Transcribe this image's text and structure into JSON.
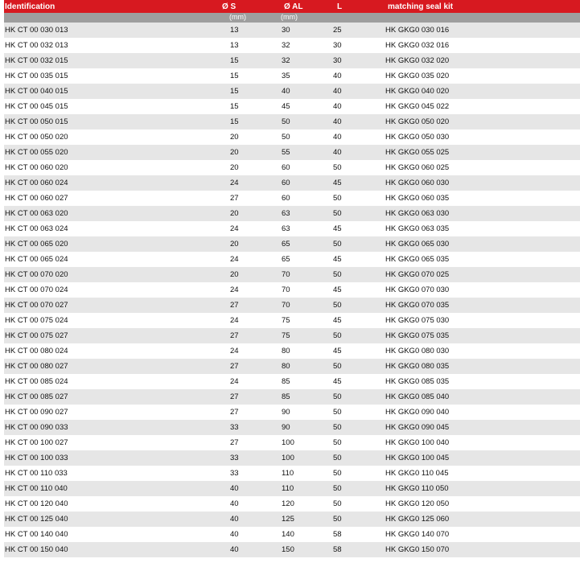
{
  "table": {
    "headers": {
      "identification": "Identification",
      "s": "Ø S",
      "al": "Ø AL",
      "l": "L",
      "kit": "matching seal kit"
    },
    "units": {
      "s": "(mm)",
      "al": "(mm)"
    },
    "rows": [
      [
        "HK CT 00 030 013",
        "13",
        "30",
        "25",
        "HK GKG0 030 016"
      ],
      [
        "HK CT 00 032 013",
        "13",
        "32",
        "30",
        "HK GKG0 032 016"
      ],
      [
        "HK CT 00 032 015",
        "15",
        "32",
        "30",
        "HK GKG0 032 020"
      ],
      [
        "HK CT 00 035 015",
        "15",
        "35",
        "40",
        "HK GKG0 035 020"
      ],
      [
        "HK CT 00 040 015",
        "15",
        "40",
        "40",
        "HK GKG0 040 020"
      ],
      [
        "HK CT 00 045 015",
        "15",
        "45",
        "40",
        "HK GKG0 045 022"
      ],
      [
        "HK CT 00 050 015",
        "15",
        "50",
        "40",
        "HK GKG0 050 020"
      ],
      [
        "HK CT 00 050 020",
        "20",
        "50",
        "40",
        "HK GKG0 050 030"
      ],
      [
        "HK CT 00 055 020",
        "20",
        "55",
        "40",
        "HK GKG0 055 025"
      ],
      [
        "HK CT 00 060 020",
        "20",
        "60",
        "50",
        "HK GKG0 060 025"
      ],
      [
        "HK CT 00 060 024",
        "24",
        "60",
        "45",
        "HK GKG0 060 030"
      ],
      [
        "HK CT 00 060 027",
        "27",
        "60",
        "50",
        "HK GKG0 060 035"
      ],
      [
        "HK CT 00 063 020",
        "20",
        "63",
        "50",
        "HK GKG0 063 030"
      ],
      [
        "HK CT 00 063 024",
        "24",
        "63",
        "45",
        "HK GKG0 063 035"
      ],
      [
        "HK CT 00 065 020",
        "20",
        "65",
        "50",
        "HK GKG0 065 030"
      ],
      [
        "HK CT 00 065 024",
        "24",
        "65",
        "45",
        "HK GKG0 065 035"
      ],
      [
        "HK CT 00 070 020",
        "20",
        "70",
        "50",
        "HK GKG0 070 025"
      ],
      [
        "HK CT 00 070 024",
        "24",
        "70",
        "45",
        "HK GKG0 070 030"
      ],
      [
        "HK CT 00 070 027",
        "27",
        "70",
        "50",
        "HK GKG0 070 035"
      ],
      [
        "HK CT 00 075 024",
        "24",
        "75",
        "45",
        "HK GKG0 075 030"
      ],
      [
        "HK CT 00 075 027",
        "27",
        "75",
        "50",
        "HK GKG0 075 035"
      ],
      [
        "HK CT 00 080 024",
        "24",
        "80",
        "45",
        "HK GKG0 080 030"
      ],
      [
        "HK CT 00 080 027",
        "27",
        "80",
        "50",
        "HK GKG0 080 035"
      ],
      [
        "HK CT 00 085 024",
        "24",
        "85",
        "45",
        "HK GKG0 085 035"
      ],
      [
        "HK CT 00 085 027",
        "27",
        "85",
        "50",
        "HK GKG0 085 040"
      ],
      [
        "HK CT 00 090 027",
        "27",
        "90",
        "50",
        "HK GKG0 090 040"
      ],
      [
        "HK CT 00 090 033",
        "33",
        "90",
        "50",
        "HK GKG0 090 045"
      ],
      [
        "HK CT 00 100 027",
        "27",
        "100",
        "50",
        "HK GKG0 100 040"
      ],
      [
        "HK CT 00 100 033",
        "33",
        "100",
        "50",
        "HK GKG0 100 045"
      ],
      [
        "HK CT 00 110 033",
        "33",
        "110",
        "50",
        "HK GKG0 110 045"
      ],
      [
        "HK CT 00 110 040",
        "40",
        "110",
        "50",
        "HK GKG0 110 050"
      ],
      [
        "HK CT 00 120 040",
        "40",
        "120",
        "50",
        "HK GKG0 120 050"
      ],
      [
        "HK CT 00 125 040",
        "40",
        "125",
        "50",
        "HK GKG0 125 060"
      ],
      [
        "HK CT 00 140 040",
        "40",
        "140",
        "58",
        "HK GKG0 140 070"
      ],
      [
        "HK CT 00 150 040",
        "40",
        "150",
        "58",
        "HK GKG0 150 070"
      ]
    ]
  }
}
